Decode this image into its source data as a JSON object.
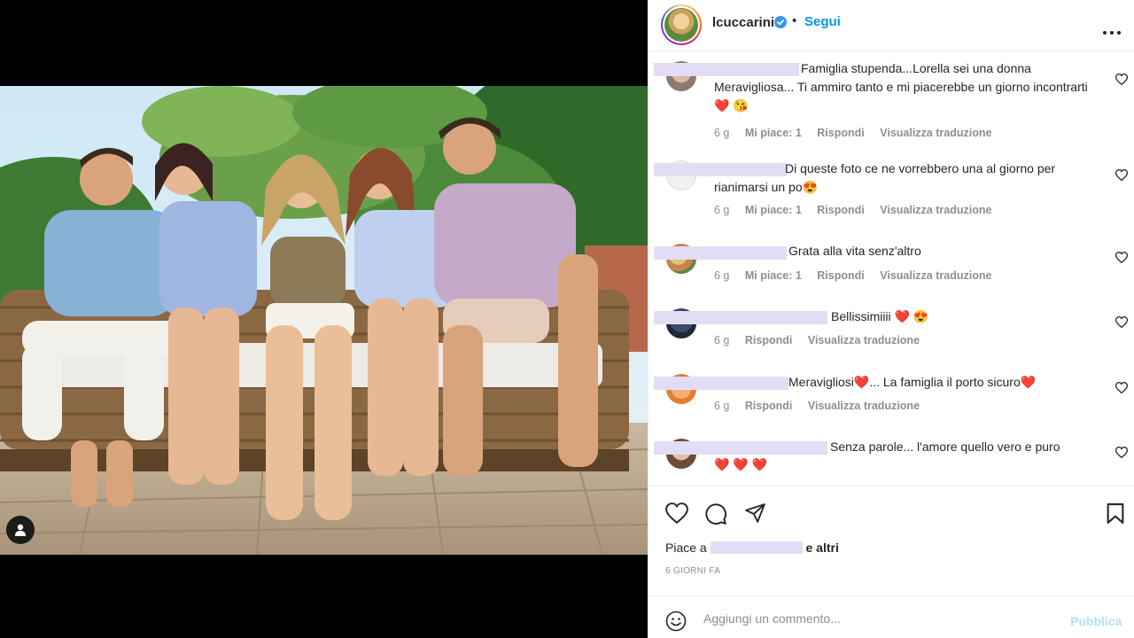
{
  "header": {
    "username": "lcuccarini",
    "verified_icon": "verified-badge-icon",
    "separator": "•",
    "follow_label": "Segui",
    "more_icon": "more-options-icon"
  },
  "comments": [
    {
      "text": "Famiglia stupenda...Lorella sei una donna Meravigliosa... Ti ammiro tanto e mi piacerebbe un giorno incontrarti ❤️ 😘",
      "time": "6 g",
      "likes": "Mi piace: 1",
      "reply": "Rispondi",
      "translate": "Visualizza traduzione"
    },
    {
      "text": "Di queste foto ce ne vorrebbero una al giorno per rianimarsi un po😍",
      "time": "6 g",
      "likes": "Mi piace: 1",
      "reply": "Rispondi",
      "translate": "Visualizza traduzione"
    },
    {
      "text": "Grata alla vita senz'altro",
      "time": "6 g",
      "likes": "Mi piace: 1",
      "reply": "Rispondi",
      "translate": "Visualizza traduzione"
    },
    {
      "text": "Bellissimiiii ❤️ 😍",
      "time": "6 g",
      "reply": "Rispondi",
      "translate": "Visualizza traduzione"
    },
    {
      "text": "Meravigliosi❤️... La famiglia il porto sicuro❤️",
      "time": "6 g",
      "reply": "Rispondi",
      "translate": "Visualizza traduzione"
    },
    {
      "text": "Senza parole... l'amore quello vero e puro",
      "text2": "❤️ ❤️ ❤️"
    }
  ],
  "actions": {
    "like_icon": "heart-icon",
    "comment_icon": "comment-icon",
    "share_icon": "share-icon",
    "save_icon": "bookmark-icon",
    "likes_prefix": "Piace a",
    "likes_suffix": "e altri",
    "date": "6 GIORNI FA"
  },
  "add_comment": {
    "emoji_icon": "emoji-icon",
    "placeholder": "Aggiungi un commento...",
    "publish_label": "Pubblica"
  },
  "media": {
    "tag_icon": "user-tag-icon"
  },
  "colors": {
    "accent": "#0095f6",
    "publish_disabled": "#b2dffc",
    "heart": "#ed1c24"
  }
}
